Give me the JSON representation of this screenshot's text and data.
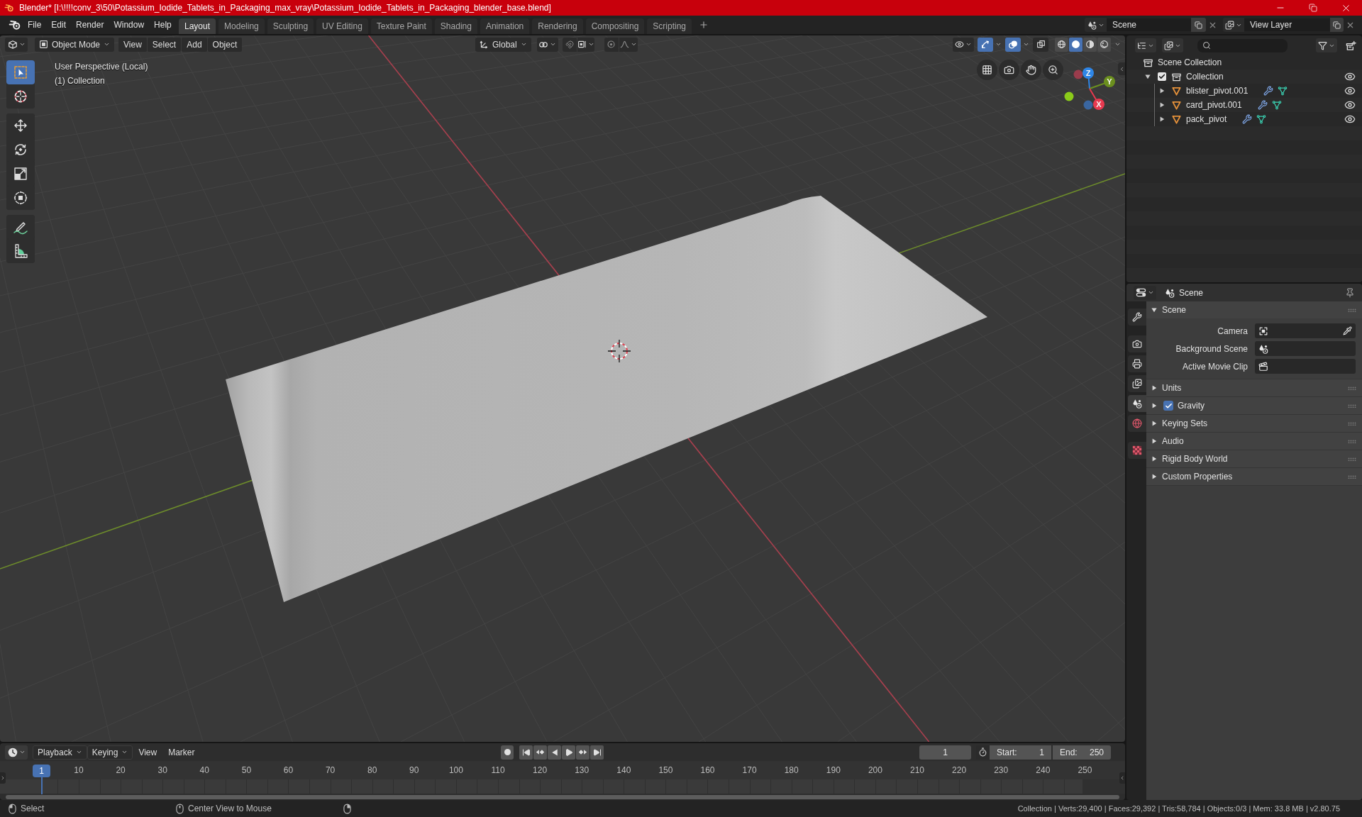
{
  "window": {
    "title": "Blender* [I:\\!!!!conv_3\\50\\Potassium_Iodide_Tablets_in_Packaging_max_vray\\Potassium_Iodide_Tablets_in_Packaging_blender_base.blend]"
  },
  "menu": [
    "File",
    "Edit",
    "Render",
    "Window",
    "Help"
  ],
  "workspaces": [
    {
      "label": "Layout",
      "selected": true
    },
    {
      "label": "Modeling",
      "selected": false
    },
    {
      "label": "Sculpting",
      "selected": false
    },
    {
      "label": "UV Editing",
      "selected": false
    },
    {
      "label": "Texture Paint",
      "selected": false
    },
    {
      "label": "Shading",
      "selected": false
    },
    {
      "label": "Animation",
      "selected": false
    },
    {
      "label": "Rendering",
      "selected": false
    },
    {
      "label": "Compositing",
      "selected": false
    },
    {
      "label": "Scripting",
      "selected": false
    }
  ],
  "scene": {
    "value": "Scene"
  },
  "view_layer": {
    "value": "View Layer"
  },
  "viewport": {
    "header": {
      "mode": "Object Mode",
      "menus": [
        "View",
        "Select",
        "Add",
        "Object"
      ],
      "orientation": "Global",
      "toggles": [
        {
          "kind": "gizmos",
          "on": true
        },
        {
          "kind": "overlays",
          "on": true
        },
        {
          "kind": "xray",
          "on": false
        }
      ],
      "shading": [
        {
          "kind": "wireframe",
          "selected": false
        },
        {
          "kind": "solid",
          "selected": true
        },
        {
          "kind": "material",
          "selected": false
        },
        {
          "kind": "rendered",
          "selected": false
        }
      ]
    },
    "info": [
      "User Perspective (Local)",
      "(1) Collection"
    ],
    "tools": [
      [
        {
          "kind": "select_box",
          "selected": true
        },
        {
          "kind": "cursor",
          "selected": false
        }
      ],
      [
        {
          "kind": "move",
          "selected": false
        },
        {
          "kind": "rotate",
          "selected": false
        },
        {
          "kind": "scale",
          "selected": false
        },
        {
          "kind": "transform",
          "selected": false
        }
      ],
      [
        {
          "kind": "annotate",
          "selected": false
        },
        {
          "kind": "measure",
          "selected": false
        }
      ]
    ],
    "axes": [
      {
        "label": "Z",
        "color": "#2e86e8"
      },
      {
        "label": "Y",
        "color": "#6b8f1e"
      },
      {
        "label": "X",
        "color": "#e8394f"
      }
    ]
  },
  "outliner": {
    "items": [
      {
        "label": "Scene Collection",
        "kind": "collection",
        "children": [
          {
            "label": "Collection",
            "kind": "collection",
            "expanded": true,
            "checked": true,
            "visible": true,
            "children": [
              {
                "label": "blister_pivot.001",
                "kind": "mesh",
                "expanded": false,
                "visible": true
              },
              {
                "label": "card_pivot.001",
                "kind": "mesh",
                "expanded": false,
                "visible": true
              },
              {
                "label": "pack_pivot",
                "kind": "mesh",
                "expanded": false,
                "visible": true
              }
            ]
          }
        ]
      }
    ]
  },
  "properties": {
    "context": "Scene",
    "tabs": [
      [
        {
          "kind": "tool",
          "selected": false
        }
      ],
      [
        {
          "kind": "render",
          "selected": false
        },
        {
          "kind": "output",
          "selected": false
        },
        {
          "kind": "view_layer",
          "selected": false
        },
        {
          "kind": "scene",
          "selected": true
        },
        {
          "kind": "world",
          "selected": false
        }
      ],
      [
        {
          "kind": "texture",
          "selected": false
        }
      ]
    ],
    "panels": [
      {
        "label": "Scene",
        "expanded": true,
        "fields": [
          {
            "label": "Camera",
            "kind": "camera"
          },
          {
            "label": "Background Scene",
            "kind": "scene"
          },
          {
            "label": "Active Movie Clip",
            "kind": "clip"
          }
        ]
      },
      {
        "label": "Units",
        "expanded": false
      },
      {
        "label": "Gravity",
        "expanded": false,
        "checked": true
      },
      {
        "label": "Keying Sets",
        "expanded": false
      },
      {
        "label": "Audio",
        "expanded": false
      },
      {
        "label": "Rigid Body World",
        "expanded": false
      },
      {
        "label": "Custom Properties",
        "expanded": false
      }
    ]
  },
  "timeline": {
    "menus": [
      {
        "label": "Playback",
        "dropdown": true
      },
      {
        "label": "Keying",
        "dropdown": true
      },
      {
        "label": "View",
        "dropdown": false
      },
      {
        "label": "Marker",
        "dropdown": false
      }
    ],
    "current_frame": "1",
    "start": {
      "label": "Start:",
      "value": "1"
    },
    "end": {
      "label": "End:",
      "value": "250"
    },
    "playhead": "1",
    "ruler": [
      "10",
      "20",
      "30",
      "40",
      "50",
      "60",
      "70",
      "80",
      "90",
      "100",
      "110",
      "120",
      "130",
      "140",
      "150",
      "160",
      "170",
      "180",
      "190",
      "200",
      "210",
      "220",
      "230",
      "240",
      "250"
    ]
  },
  "status_bar": {
    "hints": [
      "Select",
      "Center View to Mouse"
    ],
    "stats": "Collection | Verts:29,400 | Faces:29,392 | Tris:58,784 | Objects:0/3 | Mem: 33.8 MB | v2.80.75"
  }
}
